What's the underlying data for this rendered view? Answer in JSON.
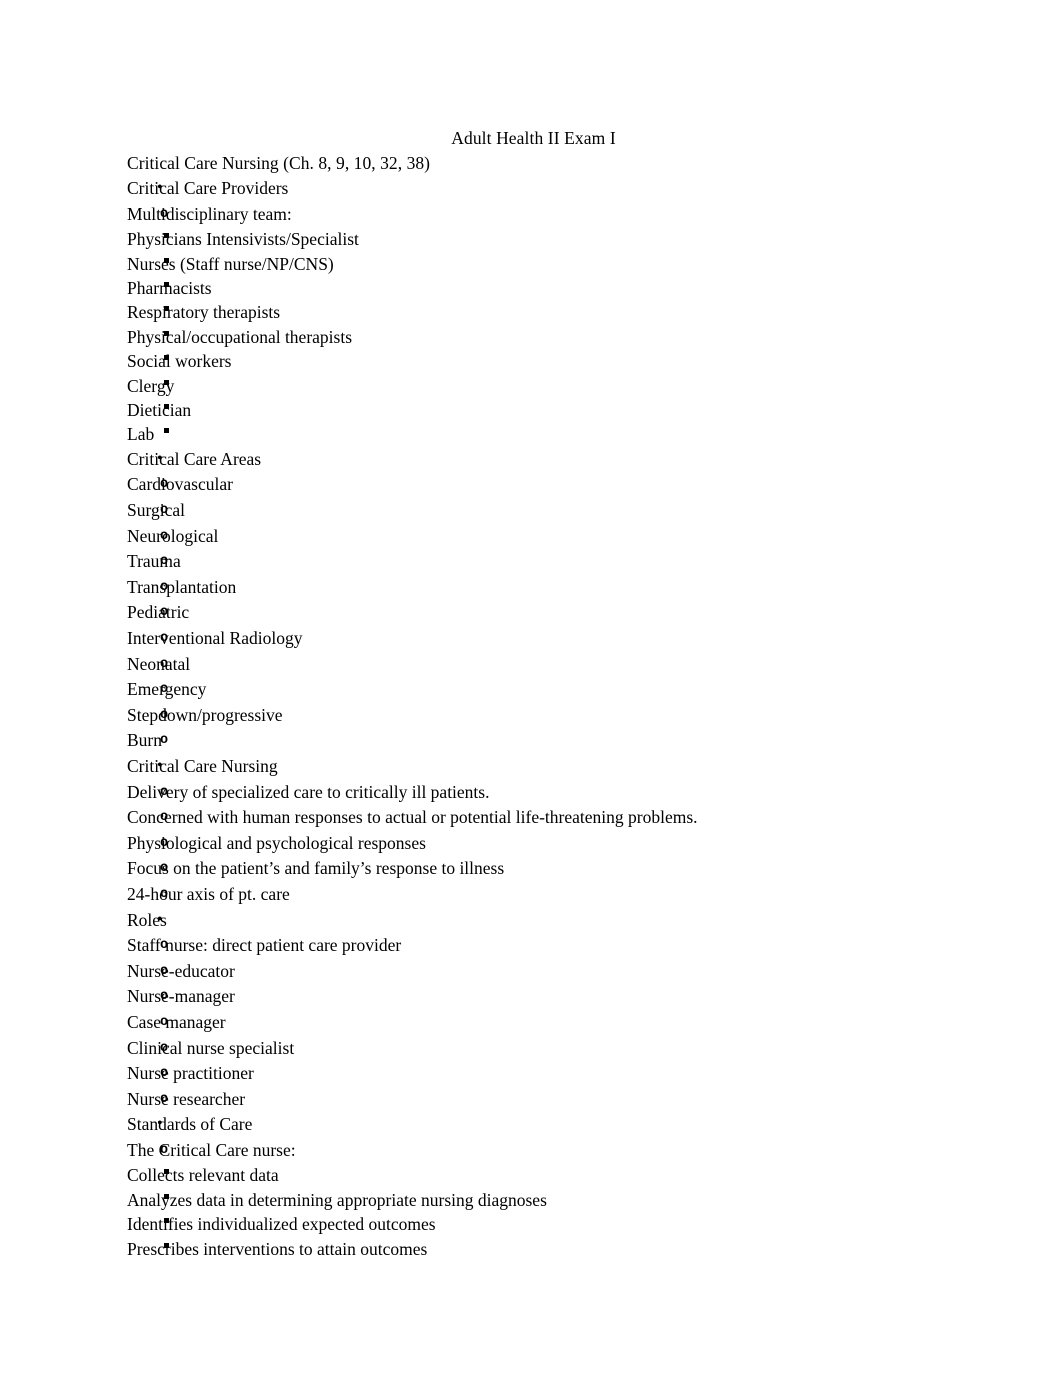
{
  "document": {
    "title": "Adult Health II Exam I",
    "subtitle": "Critical Care Nursing (Ch. 8, 9, 10, 32, 38)",
    "text_color": "#000000",
    "background_color": "#ffffff",
    "markers": {
      "level1": "•",
      "level2": "o",
      "level3": "▪"
    },
    "sections": [
      {
        "heading": "Critical Care Providers",
        "subitems": [
          {
            "label": "Multidisciplinary team:",
            "subitems": [
              "Physicians Intensivists/Specialist",
              "Nurses (Staff nurse/NP/CNS)",
              "Pharmacists",
              "Respiratory therapists",
              "Physical/occupational therapists",
              "Social workers",
              "Clergy",
              "Dietician",
              "Lab"
            ]
          }
        ]
      },
      {
        "heading": "Critical Care Areas",
        "subitems": [
          {
            "label": "Cardiovascular",
            "subitems": []
          },
          {
            "label": "Surgical",
            "subitems": []
          },
          {
            "label": "Neurological",
            "subitems": []
          },
          {
            "label": "Trauma",
            "subitems": []
          },
          {
            "label": "Transplantation",
            "subitems": []
          },
          {
            "label": "Pediatric",
            "subitems": []
          },
          {
            "label": "Interventional Radiology",
            "subitems": []
          },
          {
            "label": "Neonatal",
            "subitems": []
          },
          {
            "label": "Emergency",
            "subitems": []
          },
          {
            "label": "Stepdown/progressive",
            "subitems": []
          },
          {
            "label": "Burn",
            "subitems": []
          }
        ]
      },
      {
        "heading": "Critical Care Nursing",
        "subitems": [
          {
            "label": "Delivery of specialized care to critically ill patients.",
            "subitems": []
          },
          {
            "label": "Concerned with human responses to actual or potential life-threatening problems.",
            "subitems": []
          },
          {
            "label": "Physiological and psychological responses",
            "subitems": []
          },
          {
            "label": "Focus on the patient’s and family’s response to illness",
            "subitems": []
          },
          {
            "label": "24-hour axis of pt. care",
            "subitems": []
          }
        ]
      },
      {
        "heading": "Roles",
        "subitems": [
          {
            "label": "Staff nurse: direct patient care provider",
            "subitems": []
          },
          {
            "label": "Nurse-educator",
            "subitems": []
          },
          {
            "label": "Nurse-manager",
            "subitems": []
          },
          {
            "label": "Case manager",
            "subitems": []
          },
          {
            "label": "Clinical nurse specialist",
            "subitems": []
          },
          {
            "label": "Nurse practitioner",
            "subitems": []
          },
          {
            "label": "Nurse researcher",
            "subitems": []
          }
        ]
      },
      {
        "heading": "Standards of Care",
        "subitems": [
          {
            "label": "The Critical Care nurse:",
            "subitems": [
              "Collects relevant data",
              "Analyzes data in determining appropriate nursing diagnoses",
              "Identifies individualized expected outcomes",
              "Prescribes interventions to attain outcomes"
            ]
          }
        ]
      }
    ]
  }
}
